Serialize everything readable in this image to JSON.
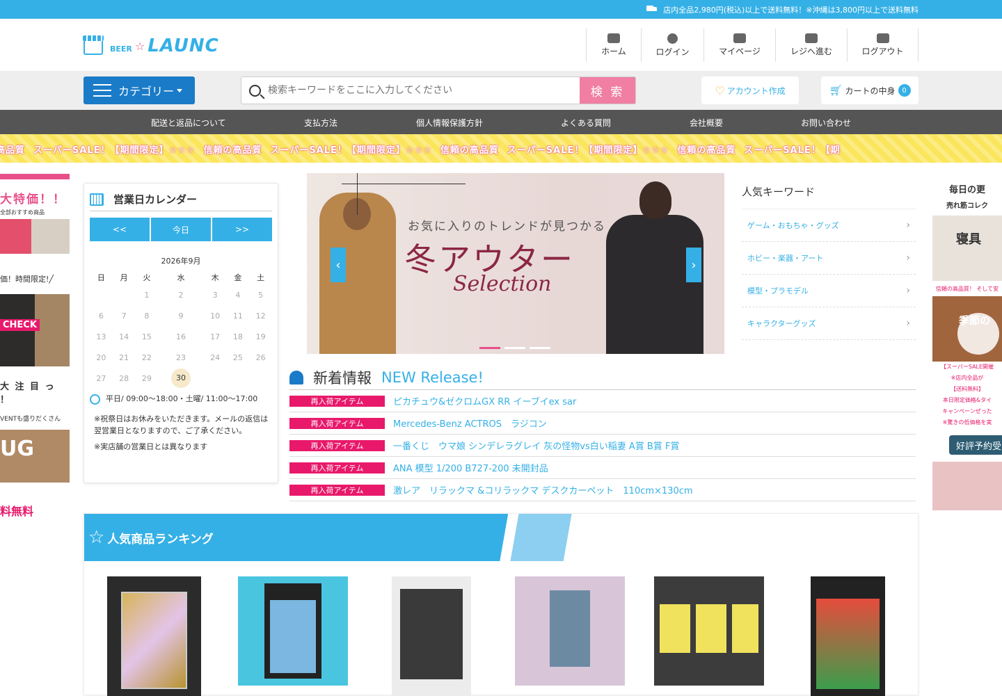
{
  "topbar": {
    "text": "店内全品2,980円(税込)以上で送料無料！※沖縄は3,800円以上で送料無料"
  },
  "logo": {
    "beer": "BEER",
    "name": "LAUNC"
  },
  "header_nav": [
    {
      "label": "ホーム",
      "icon": "home-icon"
    },
    {
      "label": "ログイン",
      "icon": "user-icon"
    },
    {
      "label": "マイページ",
      "icon": "id-card-icon"
    },
    {
      "label": "レジへ進む",
      "icon": "register-icon"
    },
    {
      "label": "ログアウト",
      "icon": "logout-icon"
    }
  ],
  "search": {
    "category_label": "カテゴリー",
    "placeholder": "検索キーワードをここに入力してください",
    "button": "検 索",
    "account": "アカウント作成",
    "cart": "カートの中身",
    "cart_count": "0"
  },
  "global_nav": [
    "配送と返品について",
    "支払方法",
    "個人情報保護方針",
    "よくある質問",
    "会社概要",
    "お問い合わせ"
  ],
  "banner": {
    "items": [
      "の高品質",
      "スーパーSALE！【期間限定】☆☆☆",
      "信頼の高品質",
      "スーパーSALE！【期間限定】☆☆☆",
      "信頼の高品質",
      "スーパーSALE！【期間限定】☆☆☆",
      "信頼の高品質",
      "スーパーSALE！【期"
    ]
  },
  "left_ads": {
    "title": "大特価！！",
    "sub": "全部おすすめ商品",
    "line2": "価！時間限定!╱",
    "check": "CHECK",
    "line3": "大 注 目 っ ！",
    "line4": "VENTも盛りだくさん",
    "ug": "UG",
    "free": "料無料"
  },
  "calendar": {
    "title": "営業日カレンダー",
    "prev": "<<",
    "today": "今日",
    "next": ">>",
    "month": "2026年9月",
    "weekdays": [
      "日",
      "月",
      "火",
      "水",
      "木",
      "金",
      "土"
    ],
    "weeks": [
      [
        "",
        "",
        "1",
        "2",
        "3",
        "4",
        "5"
      ],
      [
        "6",
        "7",
        "8",
        "9",
        "10",
        "11",
        "12"
      ],
      [
        "13",
        "14",
        "15",
        "16",
        "17",
        "18",
        "19"
      ],
      [
        "20",
        "21",
        "22",
        "23",
        "24",
        "25",
        "26"
      ],
      [
        "27",
        "28",
        "29",
        "30",
        "",
        "",
        ""
      ]
    ],
    "today_date": "30",
    "hours": "平日/ 09:00～18:00・土曜/ 11:00～17:00",
    "note1": "※祝祭日はお休みをいただきます。メールの返信は翌営業日となりますので、ご了承ください。",
    "note2": "※実店舗の営業日とは異なります"
  },
  "hero": {
    "line1": "お気に入りのトレンドが見つかる",
    "line2": "冬アウター",
    "line3": "Selection"
  },
  "keywords": {
    "title": "人気キーワード",
    "items": [
      "ゲーム・おもちゃ・グッズ",
      "ホビー・楽器・アート",
      "模型・プラモデル",
      "キャラクターグッズ"
    ]
  },
  "news": {
    "title": "新着情報",
    "title_en": "NEW Release!",
    "items": [
      {
        "tag": "再入荷アイテム",
        "text": "ピカチュウ&ゼクロムGX RR イーブイex sar"
      },
      {
        "tag": "再入荷アイテム",
        "text": "Mercedes-Benz ACTROS　ラジコン"
      },
      {
        "tag": "再入荷アイテム",
        "text": "一番くじ　ウマ娘 シンデレラグレイ 灰の怪物vs白い稲妻 A賞 B賞 F賞"
      },
      {
        "tag": "再入荷アイテム",
        "text": "ANA 模型 1/200 B727-200 未開封品"
      },
      {
        "tag": "再入荷アイテム",
        "text": "激レア　リラックマ &コリラックマ デスクカーペット　110cm×130cm"
      }
    ]
  },
  "right_ads": {
    "title": "毎日の更",
    "sub": "売れ筋コレク",
    "bed": "寝具",
    "promo_lines": [
      "信頼の高品質！ そして安",
      "【スーパーSALE開催",
      "※店内全品が",
      "【送料無料】",
      "本日限定価格&タイ",
      "キャンペーンぜった",
      "※驚きの低価格を実"
    ],
    "season": "季節の",
    "button": "好評予約受"
  },
  "ranking": {
    "title": "人気商品ランキング"
  },
  "colors": {
    "accent": "#35b0e6",
    "pink": "#e8196b",
    "nav": "#555555"
  }
}
